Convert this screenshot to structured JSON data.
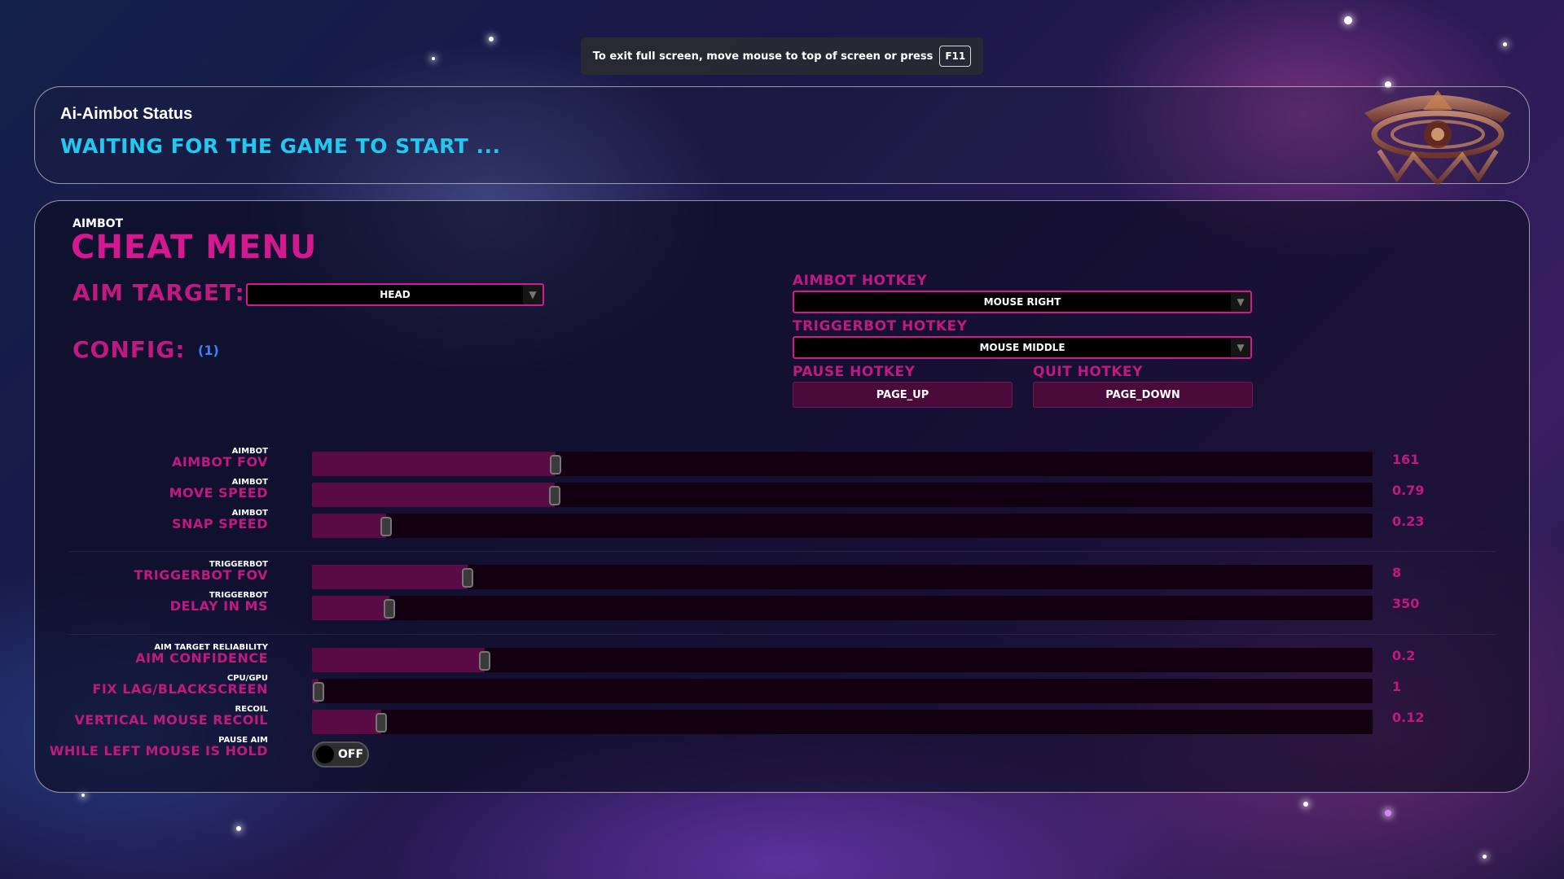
{
  "fullscreen_toast": {
    "message": "To exit full screen, move mouse to top of screen or press",
    "key": "F11"
  },
  "status": {
    "title": "Ai-Aimbot Status",
    "text": "WAITING FOR THE GAME TO START ..."
  },
  "menu": {
    "subtitle": "AIMBOT",
    "title": "CHEAT MENU",
    "aim_target_label": "AIM TARGET:",
    "aim_target_value": "HEAD",
    "config_label": "CONFIG:",
    "config_value": "(1)"
  },
  "hotkeys": {
    "aimbot_label": "AIMBOT HOTKEY",
    "aimbot_value": "MOUSE RIGHT",
    "triggerbot_label": "TRIGGERBOT HOTKEY",
    "triggerbot_value": "MOUSE MIDDLE",
    "pause_label": "PAUSE HOTKEY",
    "pause_value": "PAGE_UP",
    "quit_label": "QUIT HOTKEY",
    "quit_value": "PAGE_DOWN"
  },
  "sliders": [
    {
      "small": "AIMBOT",
      "label": "AIMBOT FOV",
      "value": "161",
      "fraction": 0.23
    },
    {
      "small": "AIMBOT",
      "label": "MOVE SPEED",
      "value": "0.79",
      "fraction": 0.229
    },
    {
      "small": "AIMBOT",
      "label": "SNAP SPEED",
      "value": "0.23",
      "fraction": 0.07
    },
    {
      "small": "TRIGGERBOT",
      "label": "TRIGGERBOT FOV",
      "value": "8",
      "fraction": 0.147
    },
    {
      "small": "TRIGGERBOT",
      "label": "DELAY IN MS",
      "value": "350",
      "fraction": 0.073
    },
    {
      "small": "AIM TARGET RELIABILITY",
      "label": "AIM CONFIDENCE",
      "value": "0.2",
      "fraction": 0.163
    },
    {
      "small": "CPU/GPU",
      "label": "FIX LAG/BLACKSCREEN",
      "value": "1",
      "fraction": 0.006
    },
    {
      "small": "RECOIL",
      "label": "VERTICAL MOUSE RECOIL",
      "value": "0.12",
      "fraction": 0.065
    }
  ],
  "pause_aim": {
    "small": "PAUSE AIM",
    "label": "WHILE LEFT MOUSE IS HOLD",
    "state": "OFF"
  },
  "colors": {
    "accent": "#d4188f",
    "status_text": "#21c8f0",
    "config_value": "#3f7fff"
  }
}
